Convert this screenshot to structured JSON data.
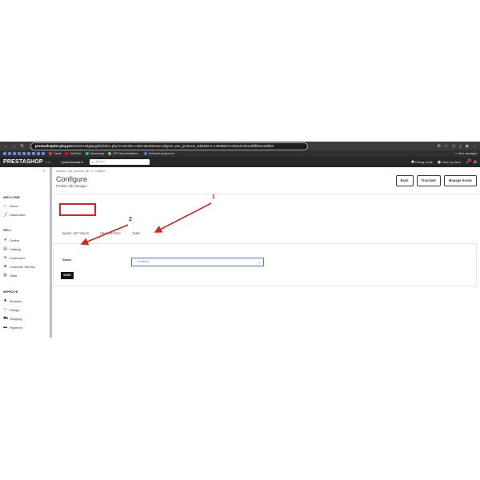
{
  "browser": {
    "url_host": "prestashop811.ploy.pro",
    "url_path": "/admin149gbpqpdhj/index.php?controller=AdminModules&configure=yse_products_tab&token=135086b7ccdac64e1b4cdfdf80a1139f82",
    "bookmarks": [
      "Gmail",
      "YouTube",
      "Grammarly",
      "API Documentation...",
      "fontsend.ploy.pro/w..."
    ],
    "all_bookmarks": "Все закладки"
  },
  "header": {
    "logo": "PRESTASHOP",
    "version": "8.1.1",
    "quick_access": "Quick Access ▾",
    "search_placeholder": "Search",
    "debug_mode": "Debug mode",
    "view_store": "View my store"
  },
  "sidebar": {
    "sections": [
      {
        "title": "WELCOME",
        "items": [
          {
            "label": "Home",
            "icon": "home-icon"
          },
          {
            "label": "Dashboard",
            "icon": "trending-up-icon"
          }
        ]
      },
      {
        "title": "SELL",
        "items": [
          {
            "label": "Orders",
            "icon": "cart-icon"
          },
          {
            "label": "Catalog",
            "icon": "store-icon"
          },
          {
            "label": "Customers",
            "icon": "user-icon"
          },
          {
            "label": "Customer Service",
            "icon": "chat-icon"
          },
          {
            "label": "Stats",
            "icon": "bar-chart-icon"
          }
        ]
      },
      {
        "title": "IMPROVE",
        "items": [
          {
            "label": "Modules",
            "icon": "puzzle-icon"
          },
          {
            "label": "Design",
            "icon": "monitor-icon"
          },
          {
            "label": "Shipping",
            "icon": "truck-icon"
          },
          {
            "label": "Payment",
            "icon": "card-icon"
          }
        ]
      }
    ]
  },
  "main": {
    "breadcrumb": "Modules  /  yse_products_tab  /  ✎ Configure",
    "title": "Configure",
    "subtitle": "Product tab manager",
    "buttons": {
      "back": "Back",
      "translate": "Translate",
      "manage_hooks": "Manage hooks"
    },
    "tabs": [
      "BASIC SETTINGS",
      "PROPERTIES",
      "TABS"
    ],
    "status_label": "Status",
    "status_value": "Enabled",
    "save_label": "SAVE"
  },
  "annotations": {
    "one": "1",
    "two": "2",
    "color": "#e01f1f"
  }
}
